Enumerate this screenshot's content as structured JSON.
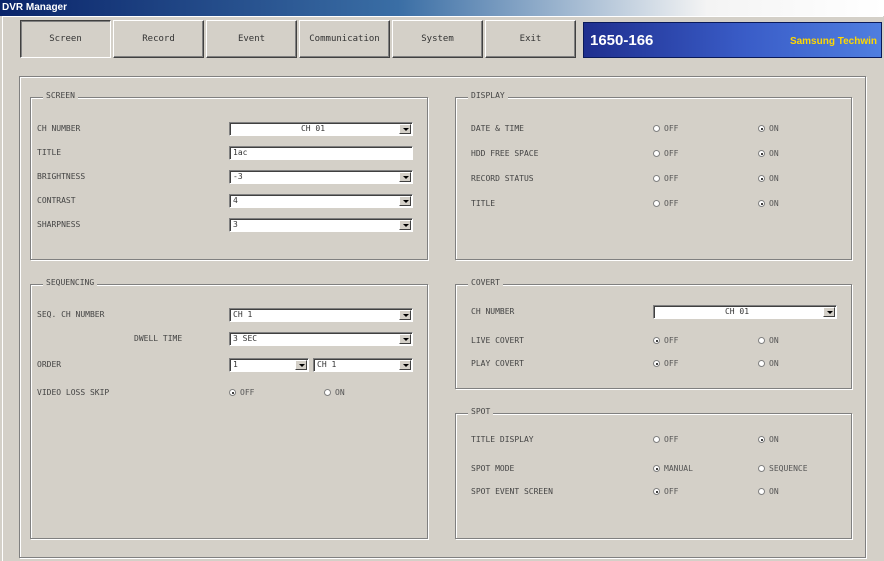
{
  "window": {
    "title": "DVR Manager"
  },
  "toolbar": {
    "buttons": [
      "Screen",
      "Record",
      "Event",
      "Communication",
      "System",
      "Exit"
    ]
  },
  "brand": {
    "model": "1650-166",
    "maker": "Samsung Techwin"
  },
  "screen": {
    "title": "SCREEN",
    "ch_number_label": "CH NUMBER",
    "ch_number_value": "CH 01",
    "title_label": "TITLE",
    "title_value": "1ac",
    "brightness_label": "BRIGHTNESS",
    "brightness_value": "-3",
    "contrast_label": "CONTRAST",
    "contrast_value": "4",
    "sharpness_label": "SHARPNESS",
    "sharpness_value": "3"
  },
  "display": {
    "title": "DISPLAY",
    "rows": [
      {
        "label": "DATE & TIME",
        "off": "OFF",
        "on": "ON",
        "selected": "on"
      },
      {
        "label": "HDD FREE SPACE",
        "off": "OFF",
        "on": "ON",
        "selected": "on"
      },
      {
        "label": "RECORD STATUS",
        "off": "OFF",
        "on": "ON",
        "selected": "on"
      },
      {
        "label": "TITLE",
        "off": "OFF",
        "on": "ON",
        "selected": "on"
      }
    ]
  },
  "sequencing": {
    "title": "SEQUENCING",
    "seq_label": "SEQ. CH NUMBER",
    "seq_value": "CH 1",
    "dwell_label": "DWELL TIME",
    "dwell_value": "3 SEC",
    "order_label": "ORDER",
    "order_value1": "1",
    "order_value2": "CH 1",
    "video_loss_label": "VIDEO LOSS SKIP",
    "video_loss_off": "OFF",
    "video_loss_on": "ON"
  },
  "covert": {
    "title": "COVERT",
    "ch_number_label": "CH NUMBER",
    "ch_number_value": "CH 01",
    "rows": [
      {
        "label": "LIVE COVERT",
        "off": "OFF",
        "on": "ON",
        "selected": "off"
      },
      {
        "label": "PLAY COVERT",
        "off": "OFF",
        "on": "ON",
        "selected": "off"
      }
    ]
  },
  "spot": {
    "title": "SPOT",
    "rows": [
      {
        "label": "TITLE DISPLAY",
        "a": "OFF",
        "b": "ON",
        "selected": "b"
      },
      {
        "label": "SPOT MODE",
        "a": "MANUAL",
        "b": "SEQUENCE",
        "selected": "a"
      },
      {
        "label": "SPOT EVENT SCREEN",
        "a": "OFF",
        "b": "ON",
        "selected": "a"
      }
    ]
  }
}
